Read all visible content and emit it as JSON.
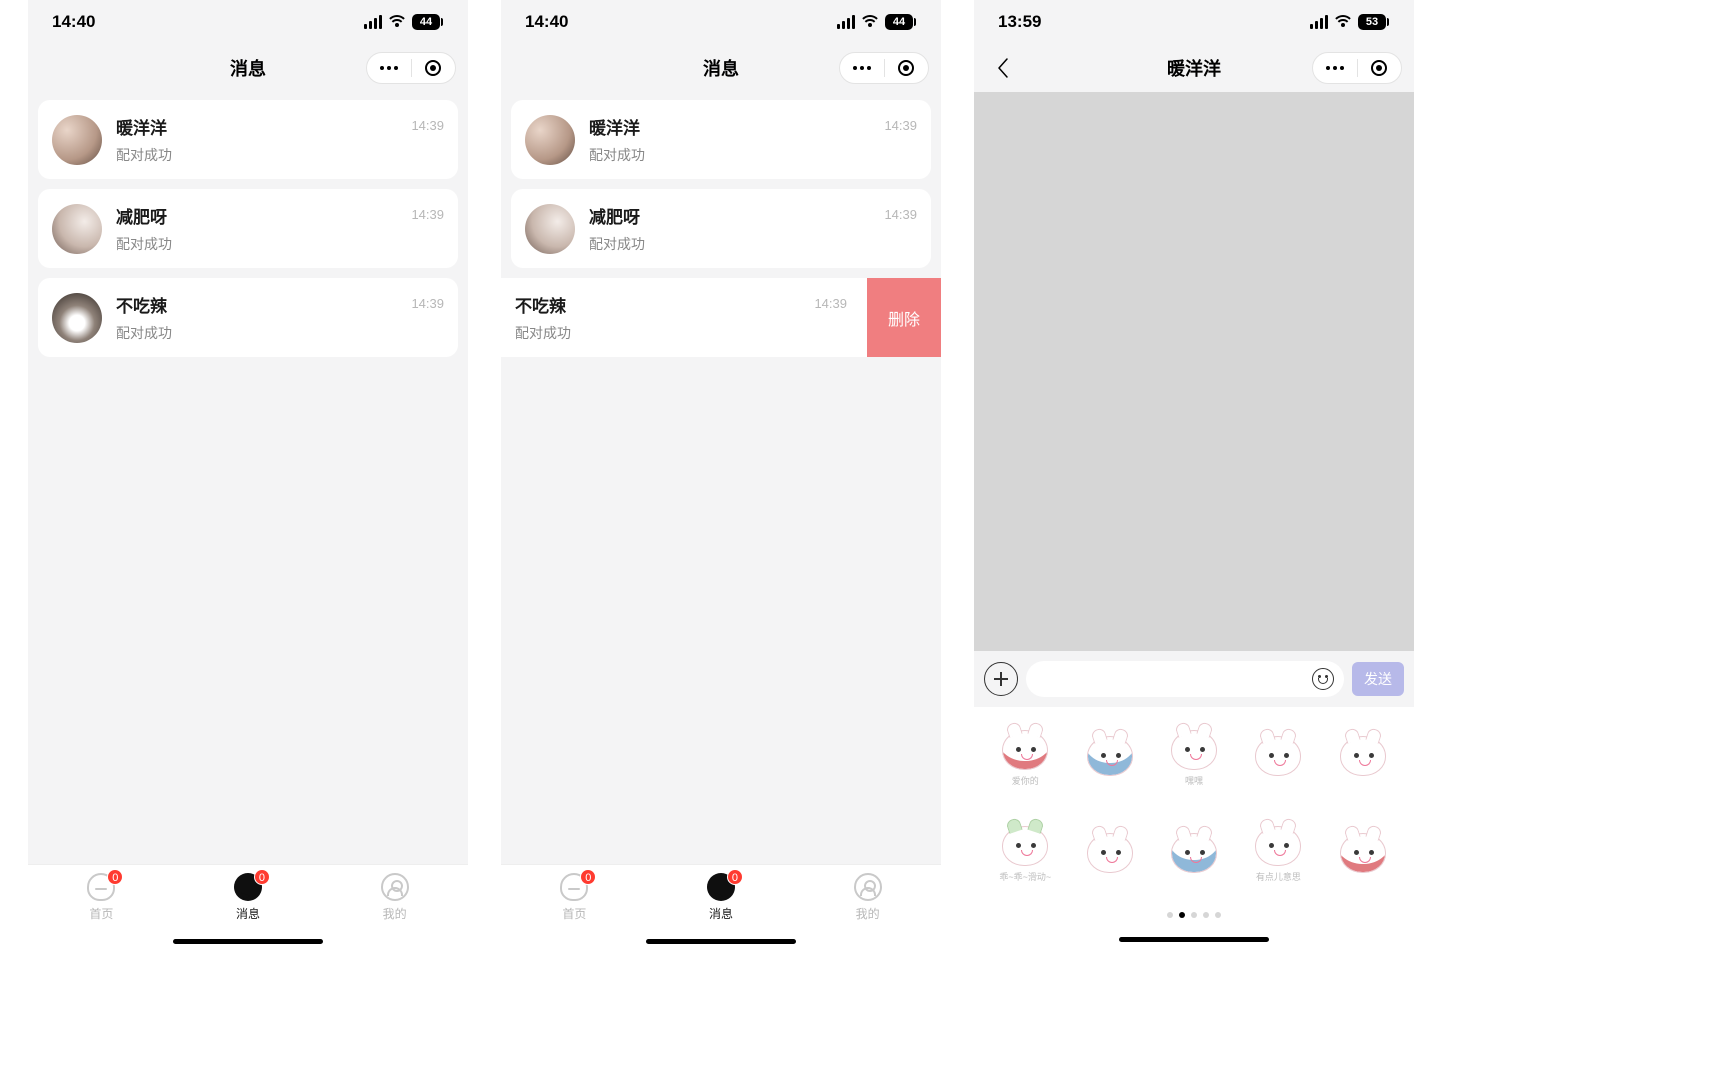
{
  "screens": [
    {
      "status": {
        "time": "14:40",
        "battery": "44"
      },
      "title": "消息",
      "items": [
        {
          "name": "暖洋洋",
          "snippet": "配对成功",
          "time": "14:39"
        },
        {
          "name": "减肥呀",
          "snippet": "配对成功",
          "time": "14:39"
        },
        {
          "name": "不吃辣",
          "snippet": "配对成功",
          "time": "14:39"
        }
      ],
      "tabs": [
        {
          "label": "首页",
          "badge": "0"
        },
        {
          "label": "消息",
          "badge": "0",
          "active": true
        },
        {
          "label": "我的"
        }
      ]
    },
    {
      "status": {
        "time": "14:40",
        "battery": "44"
      },
      "title": "消息",
      "delete_label": "删除",
      "items": [
        {
          "name": "暖洋洋",
          "snippet": "配对成功",
          "time": "14:39"
        },
        {
          "name": "减肥呀",
          "snippet": "配对成功",
          "time": "14:39"
        },
        {
          "name": "不吃辣",
          "snippet": "配对成功",
          "time": "14:39",
          "swiped": true
        }
      ],
      "tabs": [
        {
          "label": "首页",
          "badge": "0"
        },
        {
          "label": "消息",
          "badge": "0",
          "active": true
        },
        {
          "label": "我的"
        }
      ]
    },
    {
      "status": {
        "time": "13:59",
        "battery": "53"
      },
      "title": "暖洋洋",
      "send_label": "发送",
      "stickers": [
        {
          "caption": "爱你的"
        },
        {
          "caption": ""
        },
        {
          "caption": "嘿嘿"
        },
        {
          "caption": ""
        },
        {
          "caption": ""
        },
        {
          "caption": "乖~乖~滑动~"
        },
        {
          "caption": ""
        },
        {
          "caption": ""
        },
        {
          "caption": "有点儿意思"
        },
        {
          "caption": ""
        }
      ]
    }
  ]
}
